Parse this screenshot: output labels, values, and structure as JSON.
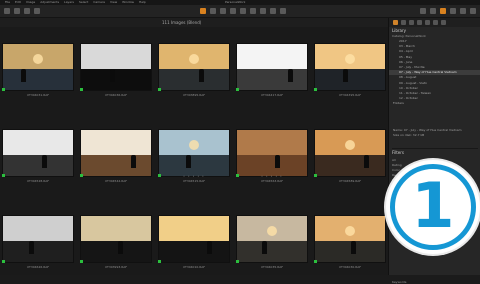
{
  "menu": {
    "items": [
      "File",
      "Edit",
      "Image",
      "Adjustments",
      "Layers",
      "Select",
      "Camera",
      "View",
      "Window",
      "Help"
    ],
    "window_title": "PersonalWork"
  },
  "viewer": {
    "count_label": "111 Images (Blend)",
    "left_label": "Info"
  },
  "thumbnails": [
    {
      "label": "XT304031.RAF",
      "stars": "",
      "scene": "sunset",
      "sky": "#c8a66a",
      "ground": "#27303a"
    },
    {
      "label": "XT304036.RAF",
      "stars": "",
      "scene": "dark",
      "sky": "#d9d9d9",
      "ground": "#0d0d0d"
    },
    {
      "label": "XT303895.RAF",
      "stars": "",
      "scene": "sunset",
      "sky": "#e0b56e",
      "ground": "#2a2e30"
    },
    {
      "label": "XT304417.RAF",
      "stars": "",
      "scene": "boat",
      "sky": "#f4f4f4",
      "ground": "#3a3a3a"
    },
    {
      "label": "XT304395.RAF",
      "stars": "",
      "scene": "sunset",
      "sky": "#f0c684",
      "ground": "#1f2328"
    },
    {
      "label": "XT304528.RAF",
      "stars": "",
      "scene": "bw",
      "sky": "#e8e8e8",
      "ground": "#333333"
    },
    {
      "label": "XT304544.RAF",
      "stars": "",
      "scene": "oars",
      "sky": "#efe5d4",
      "ground": "#6b4a2e"
    },
    {
      "label": "XT304515.RAF",
      "stars": "• • • • •",
      "scene": "sea",
      "sky": "#a9c2cf",
      "ground": "#2c3840"
    },
    {
      "label": "XT304563.RAF",
      "stars": "• • • • •",
      "scene": "basket",
      "sky": "#b07a4a",
      "ground": "#6b4226"
    },
    {
      "label": "XT304589.RAF",
      "stars": "",
      "scene": "sunset",
      "sky": "#d89a55",
      "ground": "#3a2a1f"
    },
    {
      "label": "XT304626.RAF",
      "stars": "",
      "scene": "bw",
      "sky": "#cfcfcf",
      "ground": "#1f1f1f"
    },
    {
      "label": "XT303993.RAF",
      "stars": "",
      "scene": "arch",
      "sky": "#d8c79f",
      "ground": "#151515"
    },
    {
      "label": "XT304010.RAF",
      "stars": "",
      "scene": "arch",
      "sky": "#f1cf88",
      "ground": "#141414"
    },
    {
      "label": "XT304035.RAF",
      "stars": "",
      "scene": "sunset",
      "sky": "#c7b8a0",
      "ground": "#32302c"
    },
    {
      "label": "XT304030.RAF",
      "stars": "",
      "scene": "sunset",
      "sky": "#e3b06f",
      "ground": "#2b2a26"
    }
  ],
  "sidebar": {
    "library_title": "Library",
    "library_sub": "Catalog: PersonalWork",
    "tree": [
      {
        "label": "2017",
        "selected": false
      },
      {
        "label": "03 - March",
        "selected": false
      },
      {
        "label": "04 - April",
        "selected": false
      },
      {
        "label": "05 - May",
        "selected": false
      },
      {
        "label": "06 - June",
        "selected": false
      },
      {
        "label": "07 - July - Mui Ne",
        "selected": false
      },
      {
        "label": "07 - July - Way of Hue Central Vietnam",
        "selected": true
      },
      {
        "label": "08 - August",
        "selected": false
      },
      {
        "label": "09 - August - Vietn",
        "selected": false
      },
      {
        "label": "10 - October",
        "selected": false
      },
      {
        "label": "11 - October - Taiwan",
        "selected": false
      },
      {
        "label": "12 - October",
        "selected": false
      }
    ],
    "folders_label": "Folders",
    "info_name": "Name: 07 - July - Way of Hue Central Vietnam",
    "info_size": "Size on disk: 32.7 kB",
    "filters_title": "Filters",
    "filter_rows": [
      "All",
      "Rating",
      "Color",
      "Red",
      "Green",
      "Yellow",
      "Blue",
      "Purple",
      "Folder 1",
      "Folder 2"
    ],
    "keywords_label": "Keywords"
  },
  "badge": {
    "text": "1",
    "color": "#1597d4"
  }
}
